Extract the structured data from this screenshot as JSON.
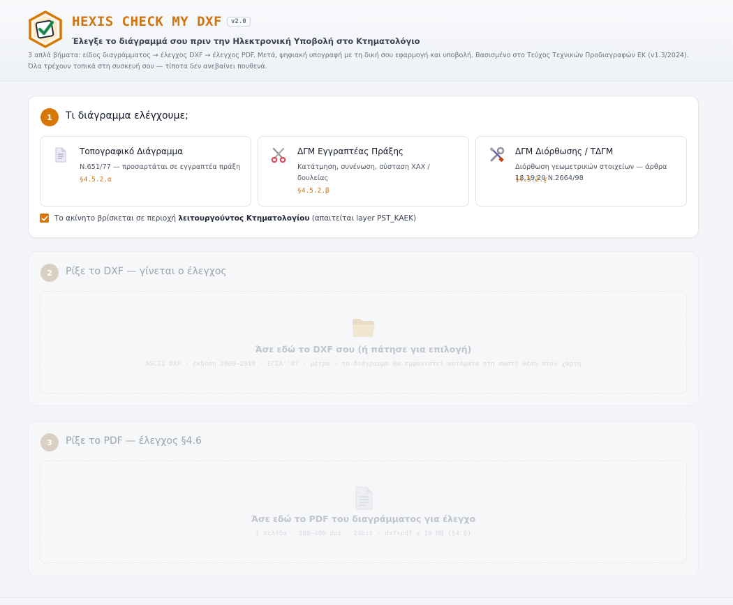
{
  "header": {
    "app_title": "HEXIS CHECK MY DXF",
    "version": "v2.0",
    "subtitle": "Έλεγξε το διάγραμμά σου πριν την Ηλεκτρονική Υποβολή στο Κτηματολόγιο",
    "description": "3 απλά βήματα: είδος διαγράμματος → έλεγχος DXF → έλεγχος PDF. Μετά, ψηφιακή υπογραφή με τη δική σου εφαρμογή και υποβολή. Βασισμένο στο Τεύχος Τεχνικών Προδιαγραφών ΕΚ (v1.3/2024). Όλα τρέχουν τοπικά στη συσκευή σου — τίποτα δεν ανεβαίνει πουθενά."
  },
  "step1": {
    "number": "1",
    "title": "Τι διάγραμμα ελέγχουμε;",
    "options": [
      {
        "icon": "document-icon",
        "title": "Τοπογραφικό Διάγραμμα",
        "desc": "Ν.651/77 — προσαρτάται σε εγγραπτέα πράξη",
        "ref": "§4.5.2.α"
      },
      {
        "icon": "scissors-icon",
        "title": "ΔΓΜ Εγγραπτέας Πράξης",
        "desc": "Κατάτμηση, συνένωση, σύσταση ΧΑΧ / δουλείας",
        "ref": "§4.5.2.β"
      },
      {
        "icon": "tools-icon",
        "title": "ΔΓΜ Διόρθωσης / ΤΔΓΜ",
        "desc": "Διόρθωση γεωμετρικών στοιχείων — άρθρα 18,19,20 Ν.2664/98",
        "ref": "§4.5.2.γ"
      }
    ],
    "checkbox": {
      "checked": true,
      "text_before": "Το ακίνητο βρίσκεται σε περιοχή ",
      "text_bold": "λειτουργούντος Κτηματολογίου",
      "text_after": " (απαιτείται layer PST_KAEK)"
    }
  },
  "step2": {
    "number": "2",
    "title": "Ρίξε το DXF — γίνεται ο έλεγχος",
    "drop_title": "Άσε εδώ το DXF σου (ή πάτησε για επιλογή)",
    "drop_hint": "ASCII DXF · έκδοση 2000–2018 · ΕΓΣΑ '87 · μέτρα — το διάγραμμα θα εμφανιστεί αυτόματα στη σωστή θέση στον χάρτη",
    "icon": "folder-icon"
  },
  "step3": {
    "number": "3",
    "title": "Ρίξε το PDF — έλεγχος §4.6",
    "drop_title": "Άσε εδώ το PDF του διαγράμματος για έλεγχο",
    "drop_hint": "1 σελίδα · 200–400 dpi · 24bit · dxf+pdf ≤ 10 MB (§4.6)",
    "icon": "file-icon"
  },
  "colors": {
    "accent": "#d97706",
    "accent_text": "#cf7412"
  }
}
